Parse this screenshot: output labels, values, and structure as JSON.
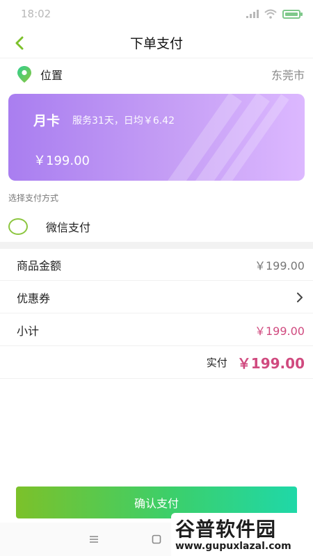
{
  "status_bar": {
    "time": "18:02"
  },
  "navbar": {
    "title": "下单支付",
    "back_icon": "chevron-left-icon"
  },
  "location": {
    "label": "位置",
    "city": "东莞市",
    "icon": "map-pin-icon"
  },
  "card": {
    "title": "月卡",
    "description": "服务31天，日均￥6.42",
    "price": "￥199.00"
  },
  "payment": {
    "caption": "选择支付方式",
    "method": "微信支付"
  },
  "summary": {
    "goods_label": "商品金额",
    "goods_value": "￥199.00",
    "coupon_label": "优惠券",
    "subtotal_label": "小计",
    "subtotal_value": "￥199.00"
  },
  "paid": {
    "label": "实付",
    "amount": "￥199.00"
  },
  "confirm_button": {
    "label": "确认支付"
  },
  "watermark": {
    "main": "谷普软件园",
    "url": "www.gupuxlazal.com"
  },
  "colors": {
    "accent_green": "#8cc63f",
    "price_pink": "#d04a7f",
    "card_purple": "#a97ef0"
  }
}
